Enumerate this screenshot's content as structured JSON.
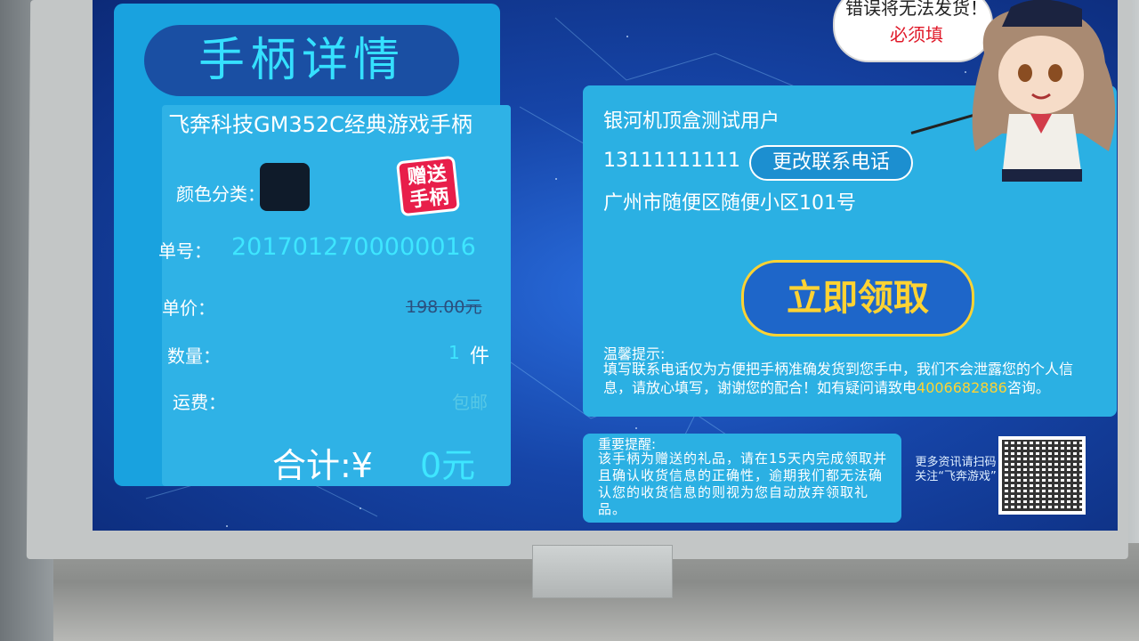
{
  "left": {
    "title": "手柄详情",
    "product_name": "飞奔科技GM352C经典游戏手柄",
    "color_label": "颜色分类：",
    "gift_badge": "赠送手柄",
    "order_label": "单号：",
    "order_no": "2017012700000016",
    "price_label": "单价：",
    "price_old": "198.00元",
    "qty_label": "数量：",
    "qty_value": "1",
    "qty_unit": "件",
    "shipping_label": "运费：",
    "shipping_value": "包邮",
    "total_label": "合计:¥",
    "total_value": "0元"
  },
  "right": {
    "user_name": "银河机顶盒测试用户",
    "phone": "13111111111",
    "change_phone": "更改联系电话",
    "address": "广州市随便区随便小区101号",
    "claim_button": "立即领取",
    "tip_title": "温馨提示:",
    "tip_text_1": "填写联系电话仅为方便把手柄准确发货到您手中，我们不会泄露您的个人信息，请放心填写，谢谢您的配合！如有疑问请致电",
    "hotline": "4006682886",
    "tip_text_2": "咨询。"
  },
  "notice": {
    "title": "重要提醒:",
    "text": "该手柄为赠送的礼品，请在15天内完成领取并且确认收货信息的正确性，逾期我们都无法确认您的收货信息的则视为您自动放弃领取礼品。"
  },
  "qr_caption": "更多资讯请扫码关注“飞奔游戏”",
  "bubble": {
    "text": "错误将无法发货！",
    "must": "必须填"
  },
  "colors": {
    "accent_cyan": "#3ee6ff",
    "accent_yellow": "#ffd332",
    "panel_blue": "#2bb0e3"
  }
}
